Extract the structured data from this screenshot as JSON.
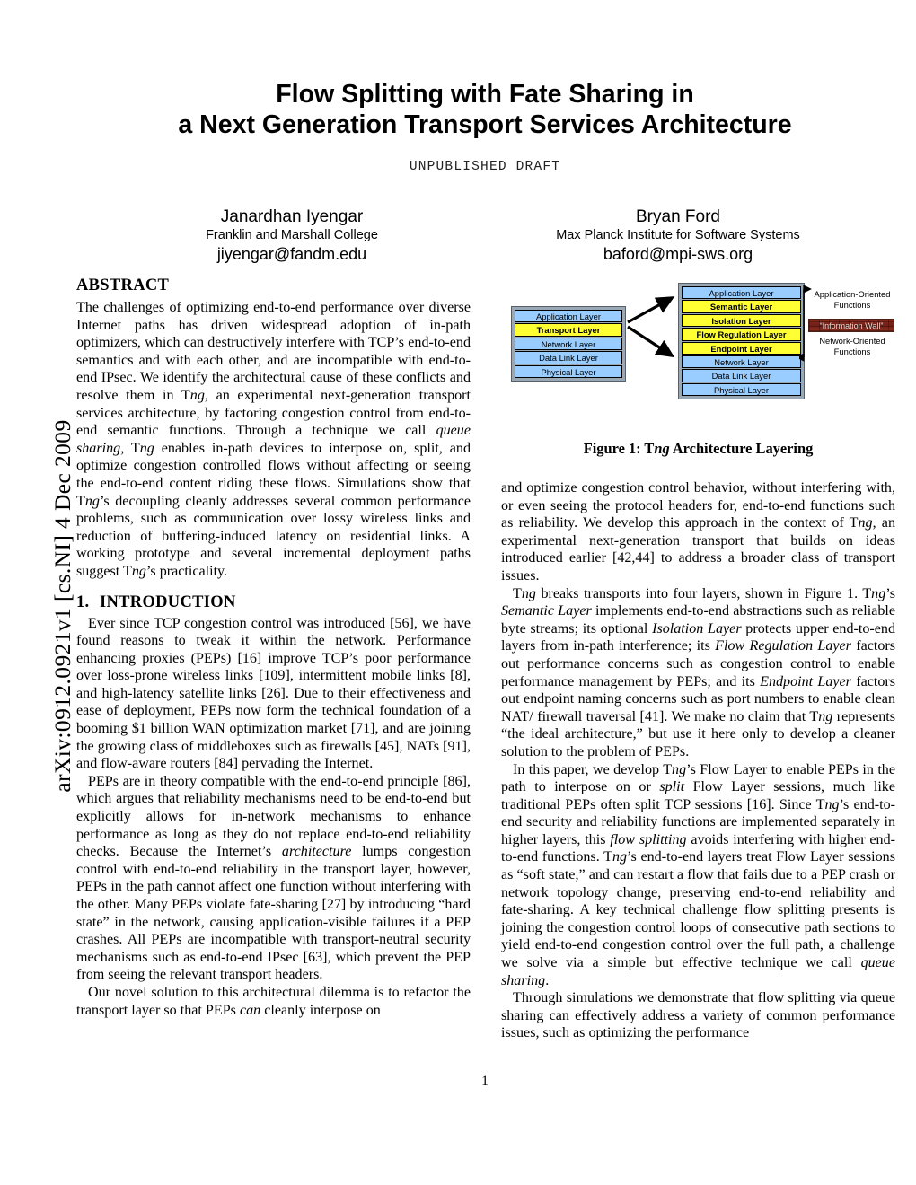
{
  "arxiv_stamp": "arXiv:0912.0921v1  [cs.NI]  4 Dec 2009",
  "title": {
    "line1": "Flow Splitting with Fate Sharing in",
    "line2": "a Next Generation Transport Services Architecture",
    "draft_note": "UNPUBLISHED DRAFT"
  },
  "authors": [
    {
      "name": "Janardhan Iyengar",
      "affiliation": "Franklin and Marshall College",
      "email": "jiyengar@fandm.edu"
    },
    {
      "name": "Bryan Ford",
      "affiliation": "Max Planck Institute for Software Systems",
      "email": "baford@mpi-sws.org"
    }
  ],
  "left_column": {
    "abstract_heading": "ABSTRACT",
    "abstract_paragraphs": [
      "The challenges of optimizing end-to-end performance over diverse Internet paths has driven widespread adoption of in-path optimizers, which can destructively interfere with TCP's end-to-end semantics and with each other, and are incompatible with end-to-end IPsec. We identify the architectural cause of these conflicts and resolve them in Tng, an experimental next-generation transport services architecture, by factoring congestion control from end-to-end semantic functions. Through a technique we call queue sharing, Tng enables in-path devices to interpose on, split, and optimize congestion controlled flows without affecting or seeing the end-to-end content riding these flows. Simulations show that Tng's decoupling cleanly addresses several common performance problems, such as communication over lossy wireless links and reduction of buffering-induced latency on residential links. A working prototype and several incremental deployment paths suggest Tng's practicality."
    ],
    "intro_number": "1.",
    "intro_heading": "INTRODUCTION",
    "intro_paragraphs": [
      "Ever since TCP congestion control was introduced [56], we have found reasons to tweak it within the network. Performance enhancing proxies (PEPs) [16] improve TCP's poor performance over loss-prone wireless links [109], intermittent mobile links [8], and high-latency satellite links [26]. Due to their effectiveness and ease of deployment, PEPs now form the technical foundation of a booming $1 billion WAN optimization market [71], and are joining the growing class of middleboxes such as firewalls [45], NATs [91], and flow-aware routers [84] pervading the Internet.",
      "PEPs are in theory compatible with the end-to-end principle [86], which argues that reliability mechanisms need to be end-to-end but explicitly allows for in-network mechanisms to enhance performance as long as they do not replace end-to-end reliability checks. Because the Internet's architecture lumps congestion control with end-to-end reliability in the transport layer, however, PEPs in the path cannot affect one function without interfering with the other. Many PEPs violate fate-sharing [27] by introducing “hard state” in the network, causing application-visible failures if a PEP crashes. All PEPs are incompatible with transport-neutral security mechanisms such as end-to-end IPsec [63], which prevent the PEP from seeing the relevant transport headers.",
      "Our novel solution to this architectural dilemma is to refactor the transport layer so that PEPs can cleanly interpose on"
    ]
  },
  "right_column": {
    "figure_caption_prefix": "Figure 1: T",
    "figure_caption_italic": "ng",
    "figure_caption_suffix": " Architecture Layering",
    "paragraphs": [
      "and optimize congestion control behavior, without interfering with, or even seeing the protocol headers for, end-to-end functions such as reliability. We develop this approach in the context of Tng, an experimental next-generation transport that builds on ideas introduced earlier [42,44] to address a broader class of transport issues.",
      "Tng breaks transports into four layers, shown in Figure 1. Tng's Semantic Layer implements end-to-end abstractions such as reliable byte streams; its optional Isolation Layer protects upper end-to-end layers from in-path interference; its Flow Regulation Layer factors out performance concerns such as congestion control to enable performance management by PEPs; and its Endpoint Layer factors out endpoint naming concerns such as port numbers to enable clean NAT/ firewall traversal [41]. We make no claim that Tng represents “the ideal architecture,” but use it here only to develop a cleaner solution to the problem of PEPs.",
      "In this paper, we develop Tng's Flow Layer to enable PEPs in the path to interpose on or split Flow Layer sessions, much like traditional PEPs often split TCP sessions [16]. Since Tng's end-to-end security and reliability functions are implemented separately in higher layers, this flow splitting avoids interfering with higher end-to-end functions. Tng's end-to-end layers treat Flow Layer sessions as “soft state,” and can restart a flow that fails due to a PEP crash or network topology change, preserving end-to-end reliability and fate-sharing. A key technical challenge flow splitting presents is joining the congestion control loops of consecutive path sections to yield end-to-end congestion control over the full path, a challenge we solve via a simple but effective technique we call queue sharing.",
      "Through simulations we demonstrate that flow splitting via queue sharing can effectively address a variety of common performance issues, such as optimizing the performance"
    ]
  },
  "figure": {
    "left_stack": [
      {
        "label": "Application Layer",
        "highlight": false
      },
      {
        "label": "Transport Layer",
        "highlight": true
      },
      {
        "label": "Network Layer",
        "highlight": false
      },
      {
        "label": "Data Link Layer",
        "highlight": false
      },
      {
        "label": "Physical Layer",
        "highlight": false
      }
    ],
    "right_stack": [
      {
        "label": "Application Layer",
        "highlight": false
      },
      {
        "label": "Semantic Layer",
        "highlight": true
      },
      {
        "label": "Isolation Layer",
        "highlight": true
      },
      {
        "label": "Flow Regulation Layer",
        "highlight": true
      },
      {
        "label": "Endpoint Layer",
        "highlight": true
      },
      {
        "label": "Network Layer",
        "highlight": false
      },
      {
        "label": "Data Link Layer",
        "highlight": false
      },
      {
        "label": "Physical Layer",
        "highlight": false
      }
    ],
    "annotations": {
      "top_label_line1": "Application-Oriented",
      "top_label_line2": "Functions",
      "wall_label": "“Information Wall”",
      "bottom_label_line1": "Network-Oriented",
      "bottom_label_line2": "Functions"
    },
    "colors": {
      "normal_layer": "#99ccff",
      "highlight_layer": "#ffff33",
      "stack_background": "#9aa7b5",
      "wall": "#7e2419"
    }
  },
  "page_number": "1"
}
